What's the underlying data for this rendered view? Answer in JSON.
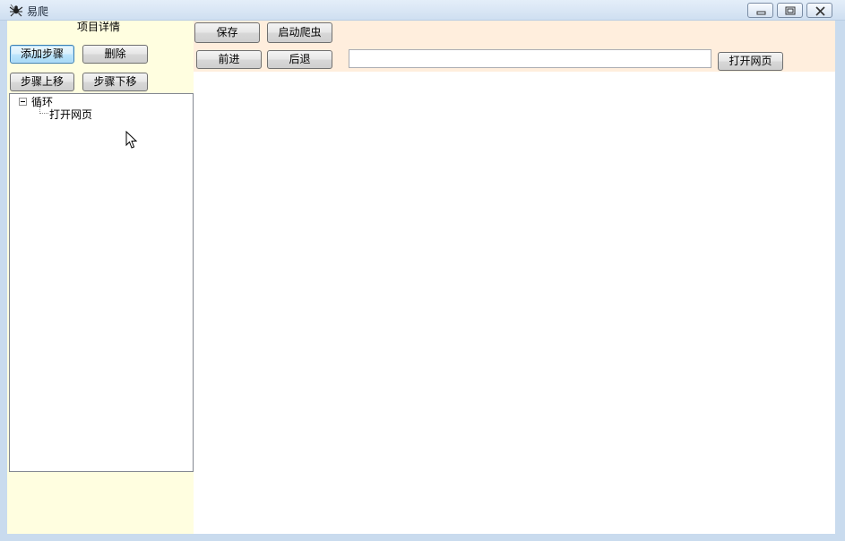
{
  "window": {
    "title": "易爬",
    "icon": "spider-app-icon",
    "controls": [
      "minimize-icon",
      "maximize-icon",
      "close-icon"
    ]
  },
  "left_panel": {
    "heading": "项目详情",
    "buttons": {
      "add_step": "添加步骤",
      "delete": "删除",
      "move_up": "步骤上移",
      "move_down": "步骤下移"
    },
    "tree": {
      "root": "循环",
      "children": [
        "打开网页"
      ]
    }
  },
  "toolbar": {
    "save": "保存",
    "start_crawler": "启动爬虫",
    "forward": "前进",
    "back": "后退",
    "open_page": "打开网页",
    "url_value": ""
  },
  "colors": {
    "left_panel_bg": "#fffee0",
    "top_panel_bg": "#ffeedd",
    "frame": "#c9dbee"
  }
}
